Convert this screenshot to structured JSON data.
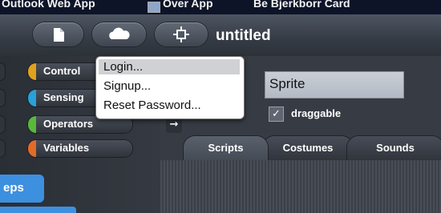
{
  "bookmarks": [
    "Outlook Web App",
    "Over App",
    "Be Bjerkborr Card"
  ],
  "toolbar": {
    "title": "untitled",
    "file_icon": "file-icon",
    "cloud_icon": "cloud-icon",
    "settings_icon": "gear-icon"
  },
  "palette": {
    "categories": [
      {
        "label": "Control",
        "color": "#e0a11f"
      },
      {
        "label": "Sensing",
        "color": "#2aa0d8"
      },
      {
        "label": "Operators",
        "color": "#59b83b"
      },
      {
        "label": "Variables",
        "color": "#e36a27"
      }
    ],
    "steps_label": "eps"
  },
  "cloud_menu": {
    "items": [
      "Login...",
      "Signup...",
      "Reset Password..."
    ],
    "highlighted": "Login..."
  },
  "sprite": {
    "name": "Sprite",
    "draggable_label": "draggable",
    "draggable_checked": true,
    "check_mark": "✓",
    "arrow_icon": "→"
  },
  "tabs": [
    "Scripts",
    "Costumes",
    "Sounds"
  ]
}
